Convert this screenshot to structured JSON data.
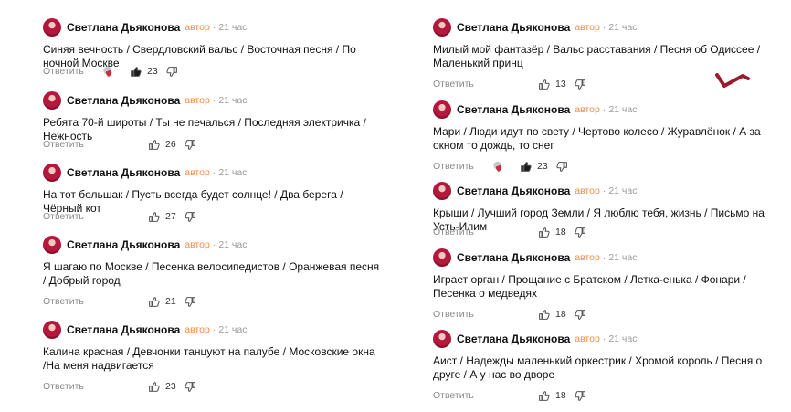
{
  "common": {
    "author": "Светлана Дьяконова",
    "badge": "автор",
    "separator": "·",
    "time": "21 час",
    "reply_label": "Ответить"
  },
  "left": [
    {
      "text": "Синяя вечность / Свердловский вальс / Восточная песня / По ночной Москве",
      "likes": "23",
      "liked": true,
      "reaction_badge": true
    },
    {
      "text": "Ребята 70-й широты / Ты не печалься / Последняя электричка / Нежность",
      "likes": "26",
      "liked": false,
      "reaction_badge": false
    },
    {
      "text": "На тот большак / Пусть всегда будет солнце! / Два берега / Чёрный кот",
      "likes": "27",
      "liked": false,
      "reaction_badge": false
    },
    {
      "text": "Я шагаю по Москве / Песенка велосипедистов / Оранжевая песня / Добрый город",
      "likes": "21",
      "liked": false,
      "reaction_badge": false
    },
    {
      "text": "Калина красная / Девчонки танцуют на палубе / Московские окна /На меня надвигается",
      "likes": "23",
      "liked": false,
      "reaction_badge": false
    }
  ],
  "right": [
    {
      "text": "Милый мой фантазёр / Вальс расставания / Песня об Одиссее / Маленький принц",
      "likes": "13",
      "liked": false,
      "reaction_badge": false
    },
    {
      "text": "Мари / Люди идут по свету / Чертово колесо / Журавлёнок / А за окном то дождь, то снег",
      "likes": "23",
      "liked": true,
      "reaction_badge": true
    },
    {
      "text": "Крыши / Лучший город Земли / Я люблю тебя, жизнь / Письмо на Усть-Илим",
      "likes": "18",
      "liked": false,
      "reaction_badge": false
    },
    {
      "text": "Играет орган / Прощание с Братском / Летка-енька / Фонари / Песенка о медведях",
      "likes": "18",
      "liked": false,
      "reaction_badge": false
    },
    {
      "text": "Аист / Надежды маленький оркестрик / Хромой король / Песня о друге / А у нас во дворе",
      "likes": "18",
      "liked": false,
      "reaction_badge": false
    }
  ],
  "colors": {
    "badge": "#f08a4b",
    "meta": "#9a9a9a",
    "avatar": "#b5173d",
    "reaction": "#d02b3c"
  },
  "icons": {
    "like": "thumbs-up-icon",
    "dislike": "thumbs-down-icon",
    "reaction": "heart-reaction-icon"
  }
}
